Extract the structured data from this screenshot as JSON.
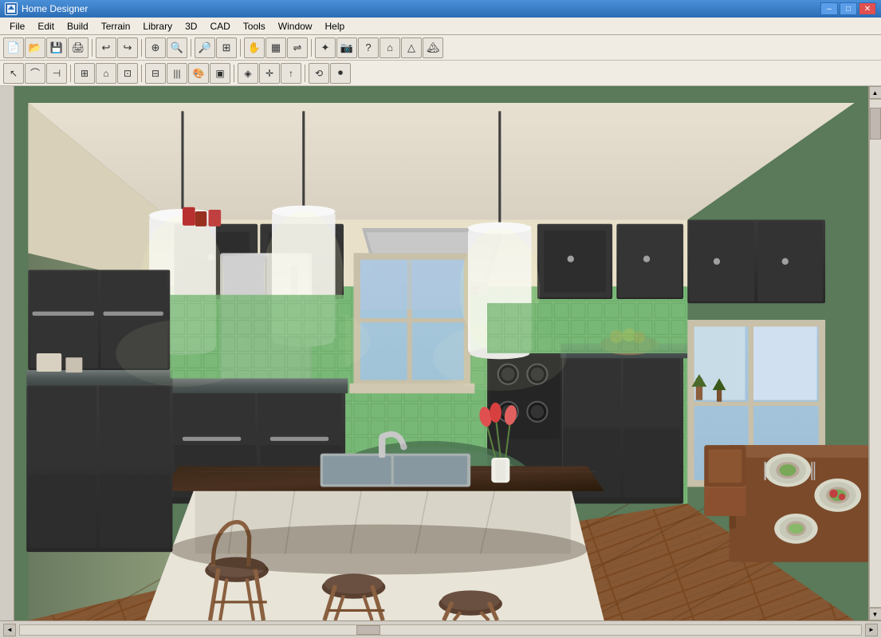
{
  "window": {
    "title": "Home Designer",
    "icon_label": "HD"
  },
  "title_bar": {
    "minimize": "–",
    "maximize": "□",
    "close": "✕"
  },
  "menu": {
    "items": [
      "File",
      "Edit",
      "Build",
      "Terrain",
      "Library",
      "3D",
      "CAD",
      "Tools",
      "Window",
      "Help"
    ]
  },
  "toolbar1": {
    "buttons": [
      {
        "name": "new",
        "icon": "📄"
      },
      {
        "name": "open",
        "icon": "📂"
      },
      {
        "name": "save",
        "icon": "💾"
      },
      {
        "name": "print",
        "icon": "🖨"
      },
      {
        "name": "undo",
        "icon": "↩"
      },
      {
        "name": "redo",
        "icon": "↪"
      },
      {
        "name": "zoom-in-real",
        "icon": "⊕"
      },
      {
        "name": "zoom-in",
        "icon": "🔍"
      },
      {
        "name": "zoom-out",
        "icon": "🔎"
      },
      {
        "name": "fit",
        "icon": "⊞"
      },
      {
        "name": "pan",
        "icon": "✋"
      },
      {
        "name": "select-objects",
        "icon": "▦"
      },
      {
        "name": "route",
        "icon": "⇌"
      },
      {
        "name": "mark",
        "icon": "✦"
      },
      {
        "name": "camera",
        "icon": "📷"
      },
      {
        "name": "help",
        "icon": "?"
      },
      {
        "name": "house",
        "icon": "⌂"
      },
      {
        "name": "roof",
        "icon": "△"
      },
      {
        "name": "terrain",
        "icon": "🏔"
      }
    ]
  },
  "toolbar2": {
    "buttons": [
      {
        "name": "select",
        "icon": "↖"
      },
      {
        "name": "polyline",
        "icon": "⌒"
      },
      {
        "name": "measure",
        "icon": "⊣"
      },
      {
        "name": "grid",
        "icon": "⊞"
      },
      {
        "name": "room",
        "icon": "⌂"
      },
      {
        "name": "door",
        "icon": "⊡"
      },
      {
        "name": "stair",
        "icon": "⊟"
      },
      {
        "name": "wall-type",
        "icon": "|||"
      },
      {
        "name": "color",
        "icon": "🎨"
      },
      {
        "name": "material",
        "icon": "▣"
      },
      {
        "name": "texture",
        "icon": "◈"
      },
      {
        "name": "move",
        "icon": "✛"
      },
      {
        "name": "arrow-up",
        "icon": "↑"
      },
      {
        "name": "transform",
        "icon": "⟲"
      },
      {
        "name": "record",
        "icon": "⏺"
      }
    ]
  },
  "scene": {
    "description": "3D kitchen interior view showing dark cabinets, granite countertops, hardwood floors, green tile backsplash, pendant lights, kitchen island with sink, and dining table",
    "background_color": "#4a6a4a"
  },
  "status_bar": {
    "left_label": "",
    "right_label": ""
  }
}
